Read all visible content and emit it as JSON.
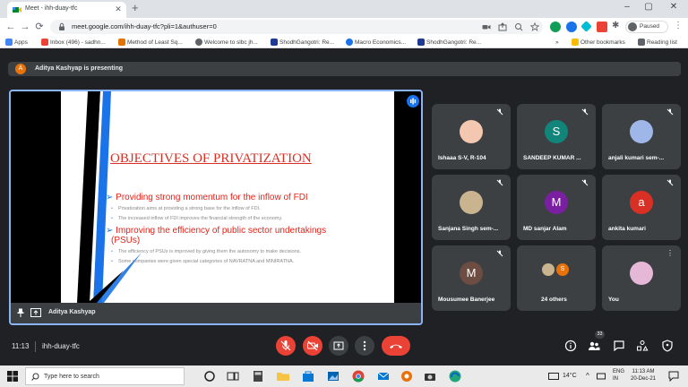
{
  "browser": {
    "tab_title": "Meet - ihh-duay-tfc",
    "url": "meet.google.com/ihh-duay-tfc?pli=1&authuser=0",
    "profile_label": "Paused"
  },
  "bookmarks": [
    {
      "label": "Apps",
      "icon": "apps-grid-icon",
      "color": "#4285f4"
    },
    {
      "label": "Inbox (496) - sadhn...",
      "icon": "gmail-icon",
      "color": "#ea4335"
    },
    {
      "label": "Method of Least Sq...",
      "icon": "e-icon",
      "color": "#e37400"
    },
    {
      "label": "Welcome to slbc jh...",
      "icon": "globe-icon",
      "color": "#5f6368"
    },
    {
      "label": "ShodhGangotri: Re...",
      "icon": "d-icon",
      "color": "#1f3a93"
    },
    {
      "label": "Macro Economics...",
      "icon": "circle-icon",
      "color": "#1a73e8"
    },
    {
      "label": "ShodhGangotri: Re...",
      "icon": "d-icon",
      "color": "#1f3a93"
    }
  ],
  "bookmarks_overflow": "»",
  "other_bookmarks": "Other bookmarks",
  "reading_list": "Reading list",
  "meet": {
    "presenter_initial": "A",
    "presenting_text": "Aditya Kashyap is presenting",
    "presentation_label": "Aditya Kashyap",
    "time": "11:13",
    "meeting_code": "ihh-duay-tfc",
    "people_count": "33"
  },
  "slide": {
    "title": "OBJECTIVES OF PRIVATIZATION",
    "heading1": "Providing strong momentum for the inflow of FDI",
    "bullets1": [
      "Privatization aims at providing a strong base for the inflow of FDI.",
      "The increased inflow of FDI improves the financial strength of the economy."
    ],
    "heading2_line1": "Improving the efficiency of public sector undertakings",
    "heading2_line2": "(PSUs)",
    "bullets2": [
      "The efficiency of PSUs is improved by giving them the autonomy to make decisions.",
      "Some companies were given special categories of NAVRATNA and MINIRATNA."
    ]
  },
  "participants": [
    {
      "name": "Ishaaa S-V, R-104",
      "type": "photo",
      "color": "#f4c7b0"
    },
    {
      "name": "SANDEEP KUMAR ...",
      "type": "initial",
      "initial": "S",
      "color": "#12857a"
    },
    {
      "name": "anjali kumari sem-...",
      "type": "photo",
      "color": "#9fb7e8"
    },
    {
      "name": "Sanjana Singh sem-...",
      "type": "photo",
      "color": "#c9b48f"
    },
    {
      "name": "MD sanjar Alam",
      "type": "initial",
      "initial": "M",
      "color": "#7b1fa2"
    },
    {
      "name": "ankita kumari",
      "type": "initial",
      "initial": "a",
      "color": "#d93025"
    },
    {
      "name": "Mousumee Banerjee",
      "type": "initial",
      "initial": "M",
      "color": "#6d4c41"
    },
    {
      "name": "24 others",
      "type": "others",
      "initial": "S",
      "color": "#e8710a"
    },
    {
      "name": "You",
      "type": "photo",
      "color": "#e6b8d8"
    }
  ],
  "taskbar": {
    "search_placeholder": "Type here to search",
    "temperature": "14°C",
    "lang_line1": "ENG",
    "lang_line2": "IN",
    "clock_time": "11:13 AM",
    "clock_date": "20-Dec-21"
  },
  "colors": {
    "meet_bg": "#202124",
    "tile_bg": "#3c4043",
    "end_call": "#ea4335",
    "presenting_border": "#8ab4f8",
    "slide_title": "#d93025"
  }
}
